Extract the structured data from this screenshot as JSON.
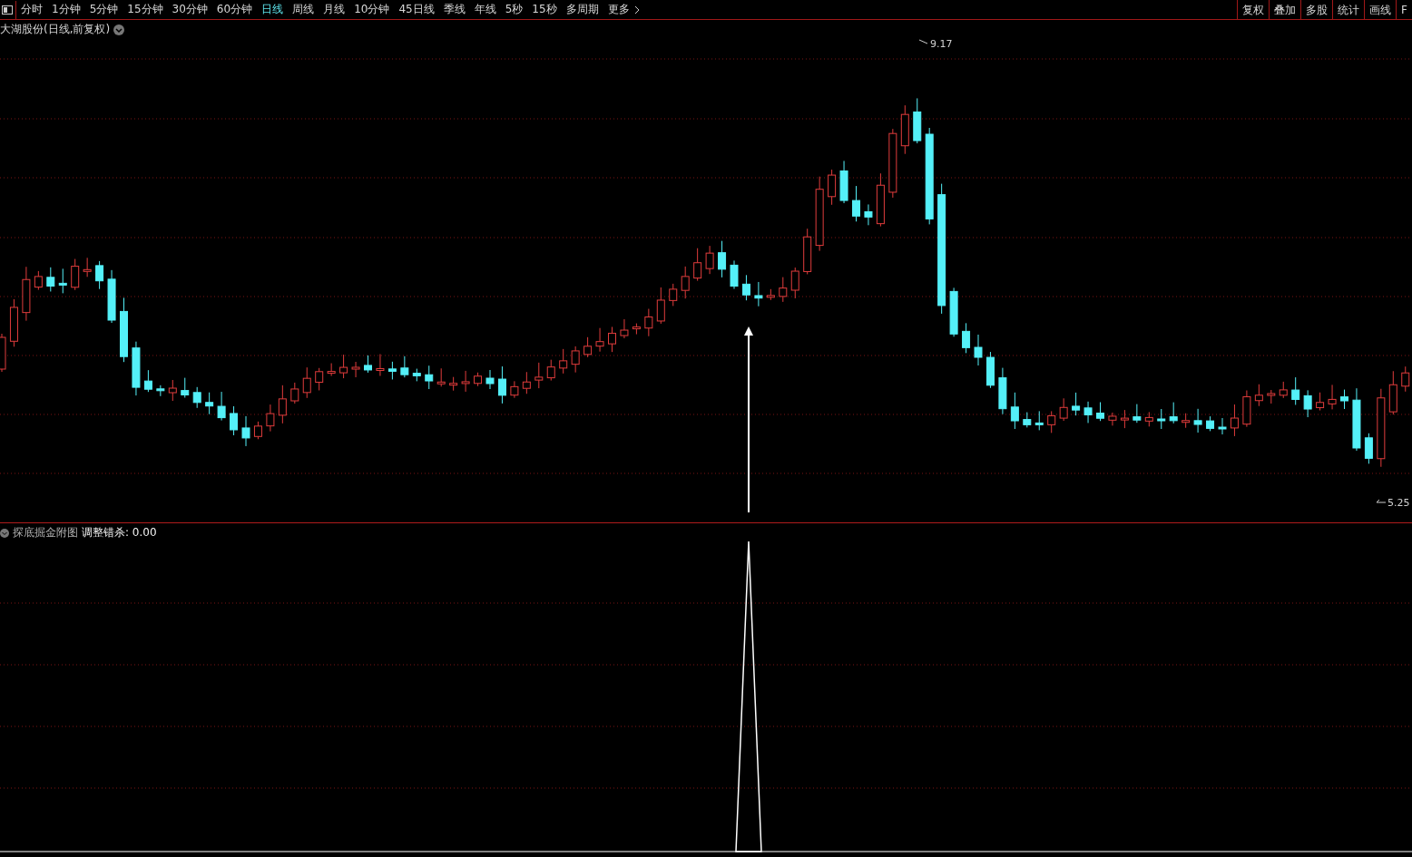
{
  "toolbar": {
    "periods": [
      {
        "label": "分时",
        "selected": false
      },
      {
        "label": "1分钟",
        "selected": false
      },
      {
        "label": "5分钟",
        "selected": false
      },
      {
        "label": "15分钟",
        "selected": false
      },
      {
        "label": "30分钟",
        "selected": false
      },
      {
        "label": "60分钟",
        "selected": false
      },
      {
        "label": "日线",
        "selected": true
      },
      {
        "label": "周线",
        "selected": false
      },
      {
        "label": "月线",
        "selected": false
      },
      {
        "label": "10分钟",
        "selected": false
      },
      {
        "label": "45日线",
        "selected": false
      },
      {
        "label": "季线",
        "selected": false
      },
      {
        "label": "年线",
        "selected": false
      },
      {
        "label": "5秒",
        "selected": false
      },
      {
        "label": "15秒",
        "selected": false
      },
      {
        "label": "多周期",
        "selected": false
      }
    ],
    "more": "更多",
    "right_buttons": [
      "复权",
      "叠加",
      "多股",
      "统计",
      "画线",
      "F"
    ]
  },
  "main_chart": {
    "title": "大湖股份(日线,前复权)",
    "high_label": "9.17",
    "low_label": "5.25"
  },
  "sub_chart": {
    "name": "探底掘金附图",
    "indicator": "调整错杀: 0.00"
  }
}
